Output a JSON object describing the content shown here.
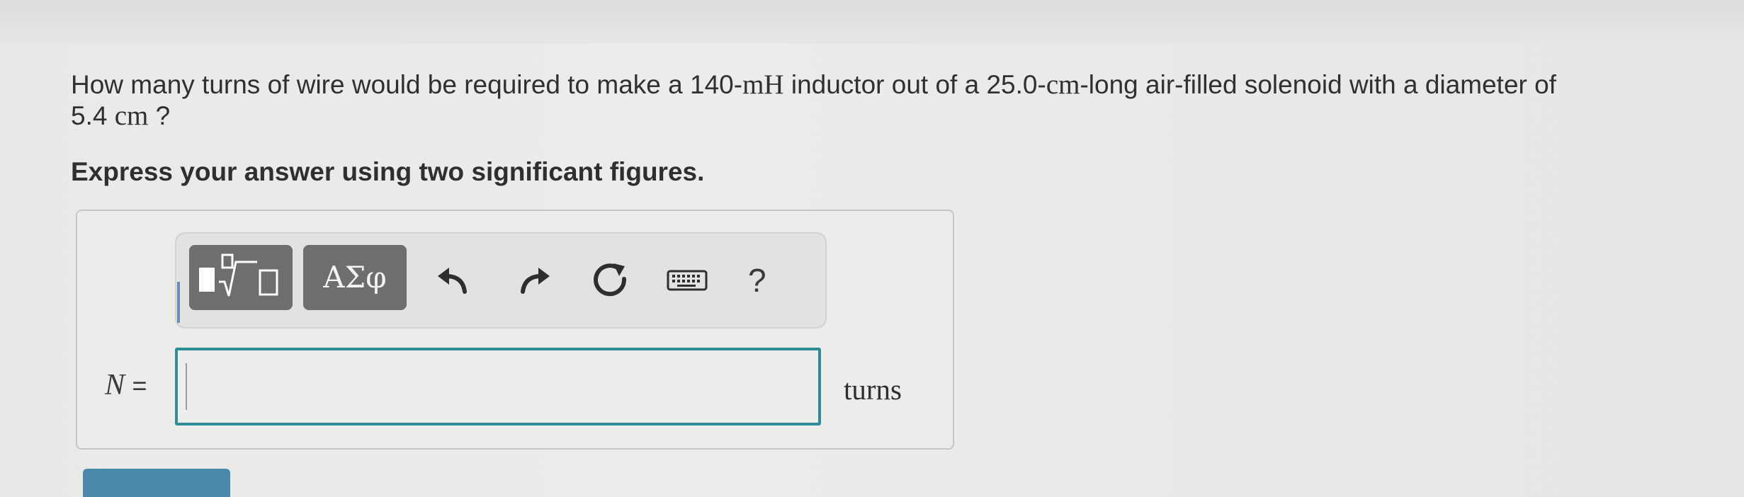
{
  "question": {
    "line1_a": "How many turns of wire would be required to make a 140-",
    "line1_unit_mh": "mH",
    "line1_b": " inductor out of a 25.0-",
    "line1_unit_cm": "cm",
    "line1_c": "-long air-filled solenoid with a diameter of",
    "line2_a": "5.4 ",
    "line2_unit_cm": "cm",
    "line2_b": " ?"
  },
  "instruction": "Express your answer using two significant figures.",
  "toolbar": {
    "templates_icon": "fraction-sqrt-icon",
    "greek_label": "ΑΣφ",
    "undo_icon": "undo-icon",
    "redo_icon": "redo-icon",
    "reset_icon": "reset-icon",
    "keyboard_icon": "keyboard-icon",
    "help_label": "?"
  },
  "answer": {
    "variable": "N",
    "equals": "=",
    "value": "",
    "unit": "turns"
  },
  "colors": {
    "input_border": "#2f8d96",
    "toolbar_button": "#6e6e70",
    "submit_button": "#4a88ab"
  }
}
